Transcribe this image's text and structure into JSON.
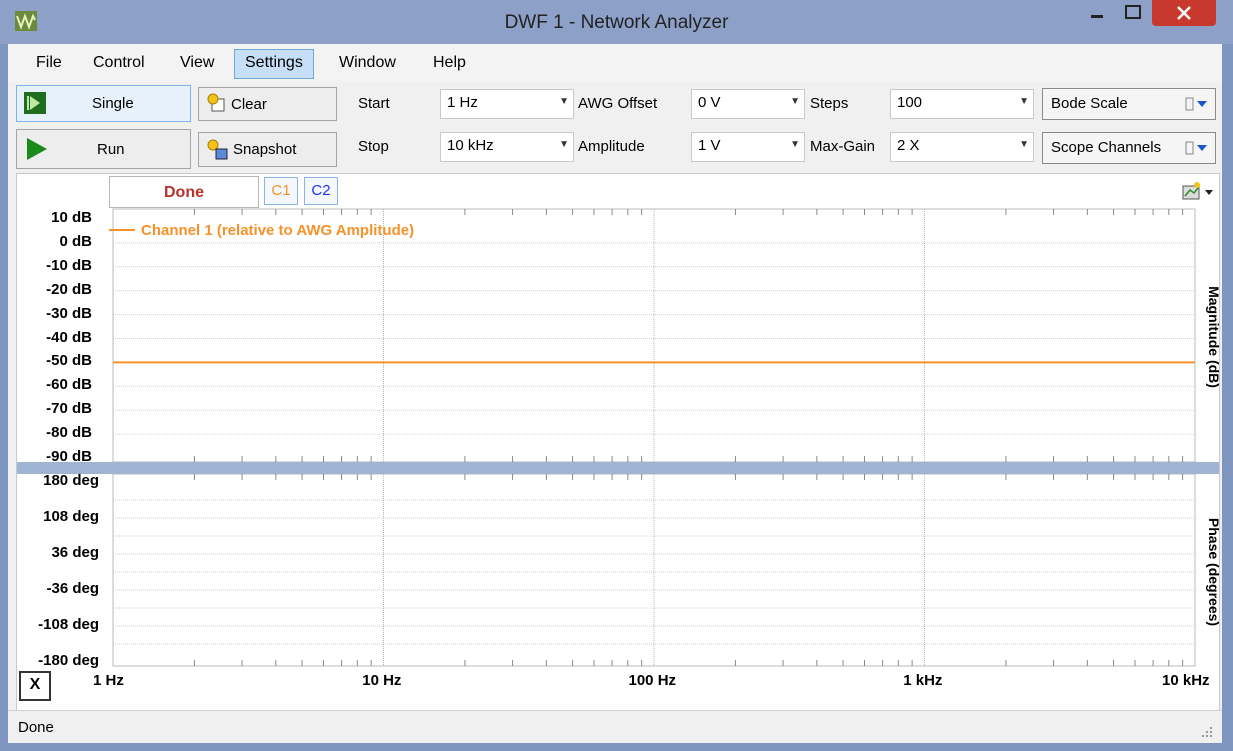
{
  "window": {
    "title": "DWF 1 - Network Analyzer"
  },
  "menu": [
    "File",
    "Control",
    "View",
    "Settings",
    "Window",
    "Help"
  ],
  "toolbar": {
    "single_label": "Single",
    "run_label": "Run",
    "clear_label": "Clear",
    "snapshot_label": "Snapshot",
    "start_label": "Start",
    "start_value": "1 Hz",
    "stop_label": "Stop",
    "stop_value": "10 kHz",
    "awg_offset_label": "AWG Offset",
    "awg_offset_value": "0 V",
    "amplitude_label": "Amplitude",
    "amplitude_value": "1 V",
    "steps_label": "Steps",
    "steps_value": "100",
    "max_gain_label": "Max-Gain",
    "max_gain_value": "2 X",
    "bode_scale_label": "Bode Scale",
    "scope_channels_label": "Scope Channels"
  },
  "plot": {
    "status": "Done",
    "c1_label": "C1",
    "c2_label": "C2",
    "x_button": "X",
    "magnitude_axis_label": "Magnitude (dB)",
    "phase_axis_label": "Phase (degrees)",
    "legend_channel1": "Channel 1 (relative to AWG Amplitude)",
    "c1_color": "#f5922a",
    "c2_color": "#2233ee"
  },
  "status_bar": {
    "text": "Done"
  },
  "chart_data": [
    {
      "type": "line",
      "title": "",
      "xlabel": "",
      "ylabel": "Magnitude (dB)",
      "xscale": "log",
      "x_ticks": [
        "1 Hz",
        "10 Hz",
        "100 Hz",
        "1 kHz",
        "10 kHz"
      ],
      "y_ticks": [
        "10 dB",
        "0 dB",
        "-10 dB",
        "-20 dB",
        "-30 dB",
        "-40 dB",
        "-50 dB",
        "-60 dB",
        "-70 dB",
        "-80 dB",
        "-90 dB"
      ],
      "xlim": [
        1,
        10000
      ],
      "ylim": [
        -90,
        10
      ],
      "grid": true,
      "legend": "top-left",
      "series": [
        {
          "name": "Channel 1 (relative to AWG Amplitude)",
          "color": "#f5922a",
          "x": [
            1,
            10000
          ],
          "y": [
            -50,
            -50
          ]
        }
      ]
    },
    {
      "type": "line",
      "title": "",
      "xlabel": "",
      "ylabel": "Phase (degrees)",
      "xscale": "log",
      "x_ticks": [
        "1 Hz",
        "10 Hz",
        "100 Hz",
        "1 kHz",
        "10 kHz"
      ],
      "y_ticks": [
        "180 deg",
        "108 deg",
        "36 deg",
        "-36 deg",
        "-108 deg",
        "-180 deg"
      ],
      "xlim": [
        1,
        10000
      ],
      "ylim": [
        -180,
        180
      ],
      "grid": true,
      "series": []
    }
  ]
}
